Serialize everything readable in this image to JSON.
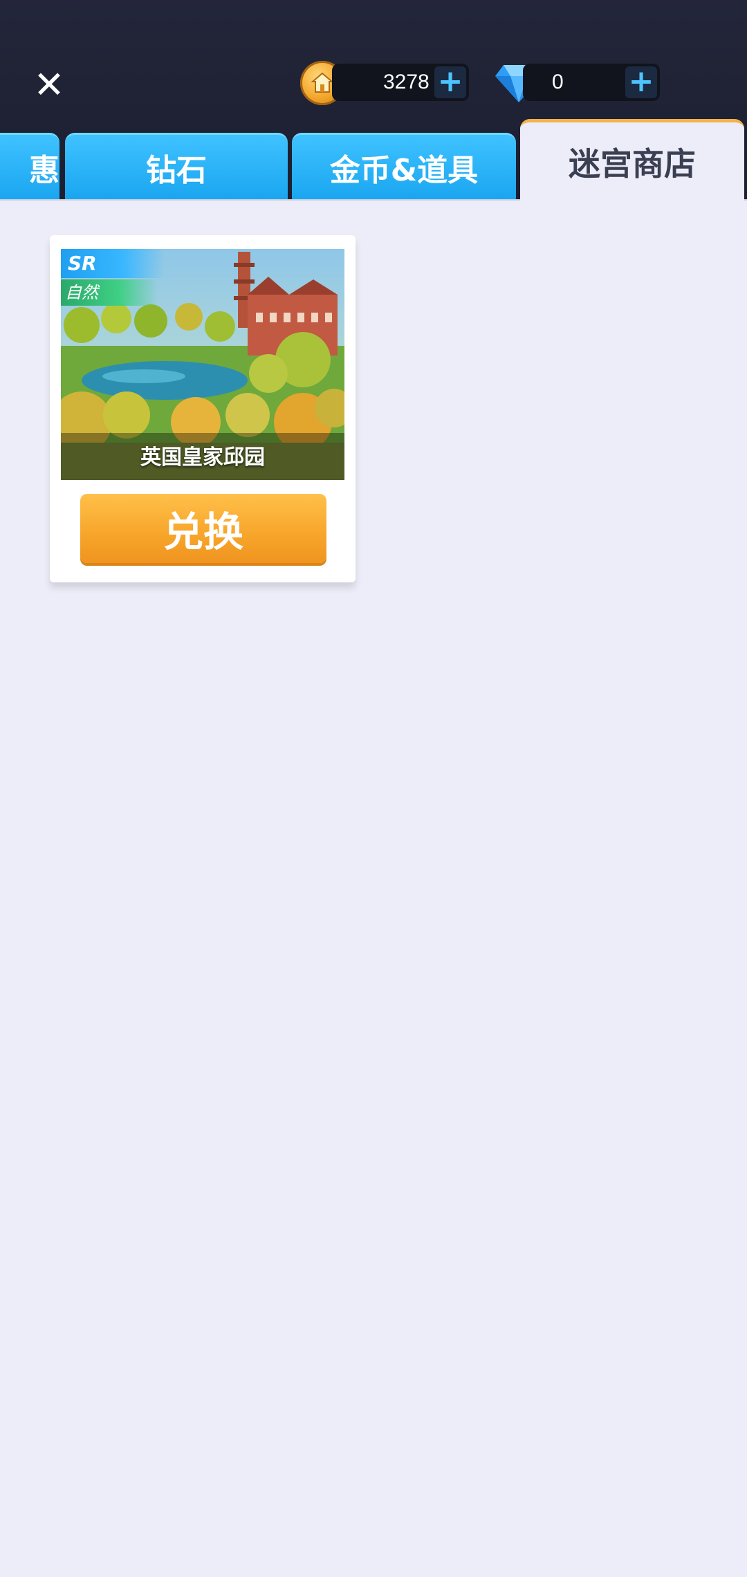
{
  "header": {
    "close_icon": "close-icon",
    "coins": {
      "value": "3278",
      "icon": "coin-icon",
      "add_icon": "plus-icon"
    },
    "gems": {
      "value": "0",
      "icon": "diamond-icon",
      "add_icon": "plus-icon"
    }
  },
  "tabs": [
    {
      "label": "惠",
      "active": false
    },
    {
      "label": "钻石",
      "active": false
    },
    {
      "label": "金币&道具",
      "active": false
    },
    {
      "label": "迷宫商店",
      "active": true
    }
  ],
  "colors": {
    "tab_blue": "#1aa6f0",
    "active_tab_accent": "#f6b24a",
    "button_orange": "#f7a52a",
    "background": "#ecedf8"
  },
  "items": [
    {
      "rarity": "SR",
      "category": "自然",
      "name": "英国皇家邱园",
      "button_label": "兑换"
    }
  ]
}
